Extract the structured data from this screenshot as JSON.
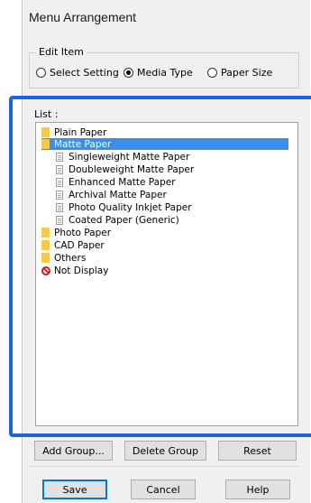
{
  "window": {
    "title": "Menu Arrangement"
  },
  "edit_item": {
    "legend": "Edit Item",
    "options": [
      {
        "label": "Select Setting",
        "checked": false
      },
      {
        "label": "Media Type",
        "checked": true
      },
      {
        "label": "Paper Size",
        "checked": false
      }
    ]
  },
  "list": {
    "label": "List :",
    "items": [
      {
        "label": "Plain Paper",
        "type": "folder",
        "level": 0,
        "selected": false
      },
      {
        "label": "Matte Paper",
        "type": "folder",
        "level": 0,
        "selected": true
      },
      {
        "label": "Singleweight Matte Paper",
        "type": "document",
        "level": 1,
        "selected": false
      },
      {
        "label": "Doubleweight Matte Paper",
        "type": "document",
        "level": 1,
        "selected": false
      },
      {
        "label": "Enhanced Matte Paper",
        "type": "document",
        "level": 1,
        "selected": false
      },
      {
        "label": "Archival Matte Paper",
        "type": "document",
        "level": 1,
        "selected": false
      },
      {
        "label": "Photo Quality Inkjet Paper",
        "type": "document",
        "level": 1,
        "selected": false
      },
      {
        "label": "Coated Paper (Generic)",
        "type": "document",
        "level": 1,
        "selected": false
      },
      {
        "label": "Photo Paper",
        "type": "folder",
        "level": 0,
        "selected": false
      },
      {
        "label": "CAD Paper",
        "type": "folder",
        "level": 0,
        "selected": false
      },
      {
        "label": "Others",
        "type": "folder",
        "level": 0,
        "selected": false
      },
      {
        "label": "Not Display",
        "type": "not-display",
        "level": 0,
        "selected": false
      }
    ]
  },
  "buttons": {
    "add_group": "Add Group...",
    "delete_group": "Delete Group",
    "reset": "Reset",
    "save": "Save",
    "cancel": "Cancel",
    "help": "Help"
  },
  "colors": {
    "highlight": "#1a66d9",
    "selection": "#3b8fe8",
    "folder": "#f7c948"
  }
}
